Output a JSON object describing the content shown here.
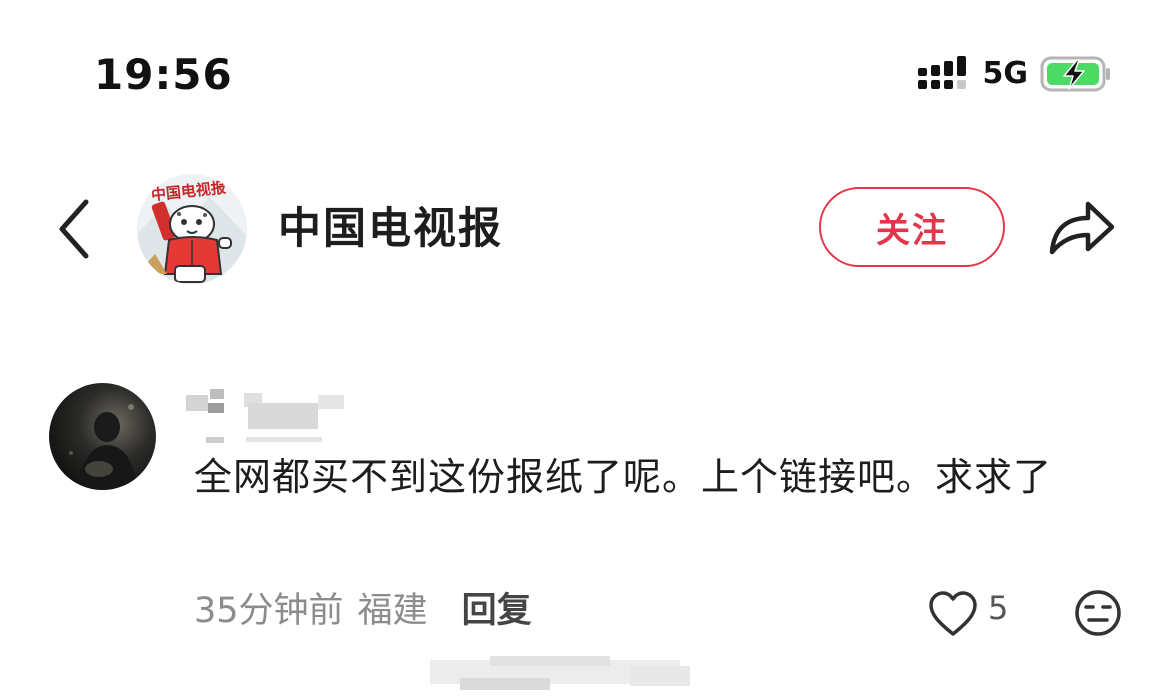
{
  "status_bar": {
    "time": "19:56",
    "network": "5G",
    "signal_icon": "signal-bars-icon",
    "battery_icon": "battery-charging-icon",
    "battery_color": "#4cd964"
  },
  "header": {
    "back_icon": "chevron-left-icon",
    "account_name": "中国电视报",
    "follow_label": "关注",
    "share_icon": "share-arrow-icon",
    "accent_color": "#e3364a"
  },
  "comment": {
    "text": "全网都买不到这份报纸了呢。上个链接吧。求求了",
    "time_ago": "35分钟前",
    "location": "福建",
    "reply_label": "回复",
    "like_count": "5",
    "like_icon": "heart-outline-icon",
    "dislike_icon": "meh-face-icon"
  }
}
